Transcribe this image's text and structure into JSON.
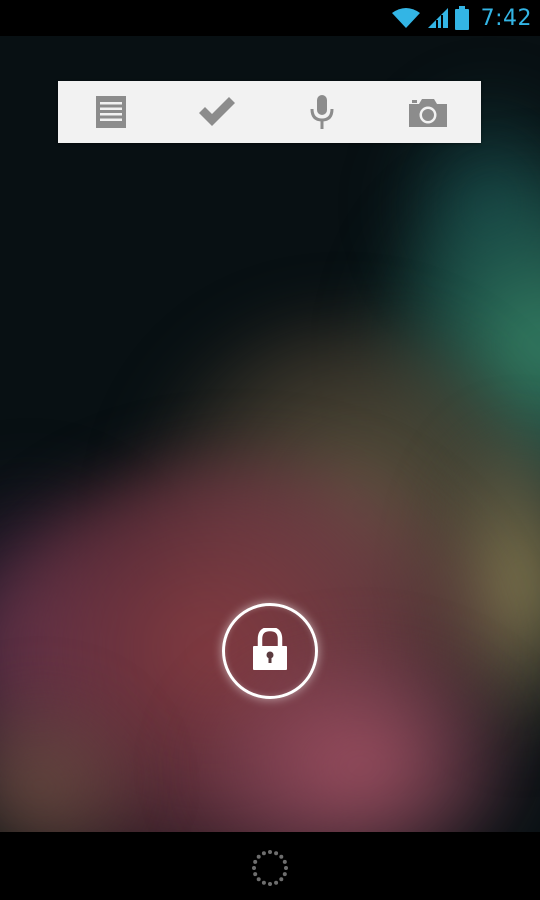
{
  "status_bar": {
    "time": "7:42",
    "accent_color": "#33b5e5",
    "icons": [
      "wifi-icon",
      "signal-icon",
      "battery-icon"
    ]
  },
  "lock_panel": {
    "actions": [
      {
        "name": "notes",
        "icon": "document-icon"
      },
      {
        "name": "tasks",
        "icon": "checkmark-icon"
      },
      {
        "name": "voice",
        "icon": "microphone-icon"
      },
      {
        "name": "camera",
        "icon": "camera-icon"
      }
    ],
    "icon_color": "#8c8c8c"
  },
  "lock": {
    "icon": "padlock-icon",
    "ring_color": "#ffffff"
  },
  "nav": {
    "icon": "loading-indicator-icon"
  }
}
